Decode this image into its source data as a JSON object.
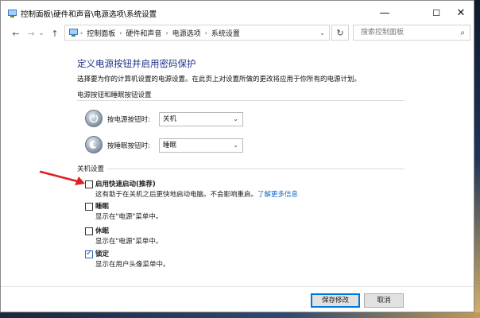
{
  "window": {
    "title": "控制面板\\硬件和声音\\电源选项\\系统设置",
    "minimize_glyph": "—",
    "maximize_glyph": "☐",
    "close_glyph": "✕"
  },
  "nav": {
    "back_glyph": "←",
    "forward_glyph": "→",
    "recent_glyph": "⌄",
    "up_glyph": "↑",
    "breadcrumbs": [
      "控制面板",
      "硬件和声音",
      "电源选项",
      "系统设置"
    ],
    "refresh_glyph": "↻",
    "search_placeholder": "搜索控制面板",
    "search_glyph": "⌕"
  },
  "page": {
    "heading": "定义电源按钮并启用密码保护",
    "description": "选择要为你的计算机设置的电源设置。在此页上对设置所做的更改将应用于你所有的电源计划。",
    "power_section_label": "电源按钮和睡眠按钮设置",
    "power_button_label": "按电源按钮时:",
    "power_button_value": "关机",
    "sleep_button_label": "按睡眠按钮时:",
    "sleep_button_value": "睡眠",
    "shutdown_section_label": "关机设置",
    "options": [
      {
        "title": "启用快速启动(推荐)",
        "desc": "这有助于在关机之后更快地启动电脑。不会影响重启。",
        "link": "了解更多信息",
        "checked": false
      },
      {
        "title": "睡眠",
        "desc": "显示在\"电源\"菜单中。",
        "checked": false
      },
      {
        "title": "休眠",
        "desc": "显示在\"电源\"菜单中。",
        "checked": false
      },
      {
        "title": "锁定",
        "desc": "显示在用户头像菜单中。",
        "checked": true
      }
    ]
  },
  "footer": {
    "save_label": "保存修改",
    "cancel_label": "取消"
  },
  "colors": {
    "heading": "#1e3287",
    "link": "#1565c0",
    "annotation_arrow": "#e02020",
    "primary_border": "#0078d7"
  }
}
